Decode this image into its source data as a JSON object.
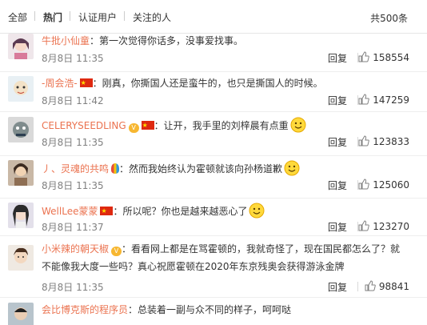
{
  "tabs": {
    "all": "全部",
    "hot": "热门",
    "verified": "认证用户",
    "following": "关注的人"
  },
  "total": "共500条",
  "reply_label": "回复",
  "colors": {
    "username": "#eb7350",
    "meta": "#808080",
    "flag": "#de2910"
  },
  "comments": [
    {
      "user": "牛批小仙童",
      "text": "：第一次觉得你话多，没事爱找事。",
      "date": "8月8日",
      "time": "11:35",
      "likes": "158554",
      "badges": []
    },
    {
      "user": "-周会浩-",
      "text": "：刚真，你撕国人还是蛮牛的，也只是撕国人的时候。",
      "date": "8月8日",
      "time": "11:42",
      "likes": "147259",
      "badges": [
        "flag"
      ]
    },
    {
      "user": "CELERYSEEDLING",
      "text": "：让开，我手里的刘梓晨有点重",
      "date": "8月8日",
      "time": "11:35",
      "likes": "123833",
      "badges": [
        "vip",
        "flag",
        "smiley"
      ]
    },
    {
      "user": "丿、灵魂的共鸣",
      "text": "：然而我始终认为霍顿就该向孙杨道歉",
      "date": "8月8日",
      "time": "11:35",
      "likes": "125060",
      "badges": [
        "balloon",
        "smiley"
      ]
    },
    {
      "user": "WellLee蒙蒙",
      "text": "：所以呢？你也是越来越恶心了",
      "date": "8月8日",
      "time": "11:37",
      "likes": "123270",
      "badges": [
        "flag",
        "smiley"
      ]
    },
    {
      "user": "小米辣的朝天椒",
      "text": "：看看网上都是在骂霍顿的，我就奇怪了，现在国民都怎么了？就不能像我大度一些吗？真心祝愿霍顿在2020年东京残奥会获得游泳金牌",
      "date": "8月8日",
      "time": "11:35",
      "likes": "98841",
      "badges": [
        "vip"
      ]
    },
    {
      "user": "会比博克斯的程序员",
      "text": "：总装着一副与众不同的样子，呵呵哒",
      "date": "",
      "time": "",
      "likes": "",
      "badges": []
    }
  ]
}
